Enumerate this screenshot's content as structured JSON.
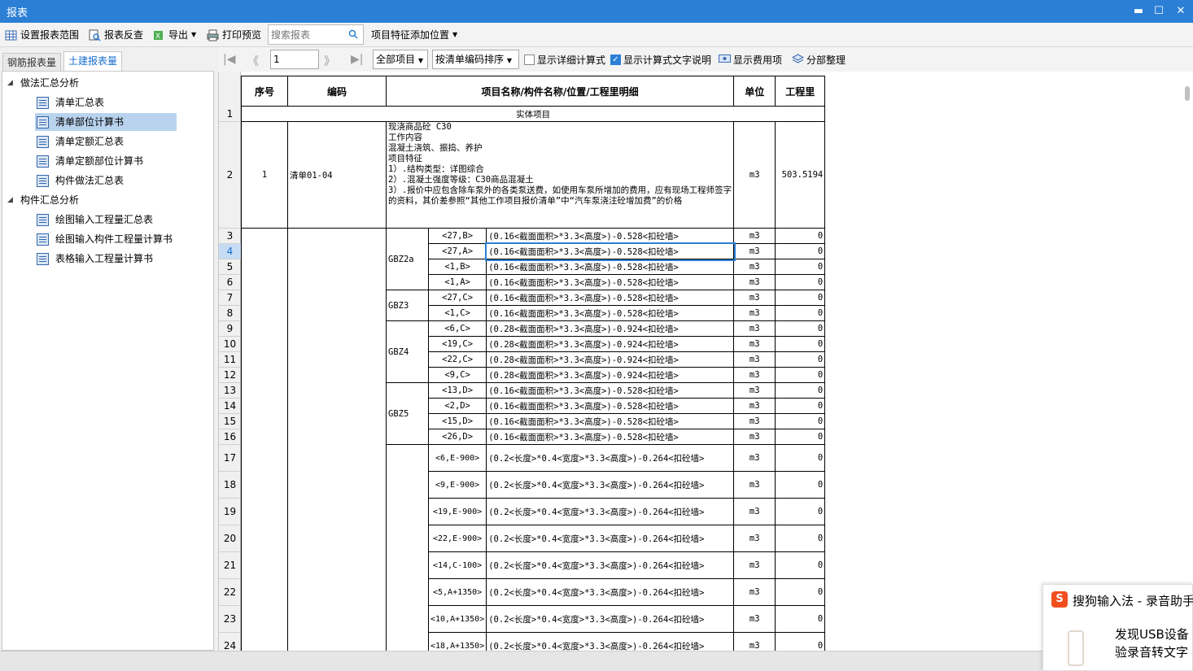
{
  "window": {
    "title": "报表",
    "minimize": "▬",
    "maximize": "☐",
    "close": "✕"
  },
  "toolbar": {
    "set_range": "设置报表范围",
    "reverse_check": "报表反查",
    "export": "导出",
    "print_preview": "打印预览",
    "search_placeholder": "搜索报表",
    "add_feature_pos": "项目特征添加位置"
  },
  "tabs": {
    "rebar": "钢筋报表量",
    "civil": "土建报表量"
  },
  "tree": {
    "group1": "做法汇总分析",
    "items1": [
      "清单汇总表",
      "清单部位计算书",
      "清单定额汇总表",
      "清单定额部位计算书",
      "构件做法汇总表"
    ],
    "group2": "构件汇总分析",
    "items2": [
      "绘图输入工程量汇总表",
      "绘图输入构件工程量计算书",
      "表格输入工程量计算书"
    ]
  },
  "nav": {
    "page": "1",
    "filter": "全部项目",
    "sort": "按清单编码排序",
    "show_detail": "显示详细计算式",
    "show_text": "显示计算式文字说明",
    "show_cost": "显示费用项",
    "split": "分部整理"
  },
  "table": {
    "headers": {
      "seq": "序号",
      "code": "编码",
      "name": "项目名称/构件名称/位置/工程里明细",
      "unit": "单位",
      "qty": "工程里"
    },
    "section": "实体项目",
    "item": {
      "seq": "1",
      "code": "清单01-04",
      "desc": "现浇商品砼 C30\n工作内容\n混凝土浇筑、振捣、养护\n项目特征\n1）.结构类型：详图综合\n2）.混凝土强度等级：C30商品混凝土\n3）.报价中应包含除车泵外的各类泵送费，如使用车泵所增加的费用，应有现场工程师签字的资料，其价差参照“其他工作项目报价清单”中“汽车泵浇注砼增加费”的价格",
      "unit": "m3",
      "qty": "503.5194"
    },
    "rows": [
      {
        "n": "3",
        "comp": "GBZ2a",
        "loc": "<27,B>",
        "formula": "(0.16<截面面积>*3.3<高度>)-0.528<扣砼墙>",
        "unit": "m3",
        "qty": "0"
      },
      {
        "n": "4",
        "comp": "",
        "loc": "<27,A>",
        "formula": "(0.16<截面面积>*3.3<高度>)-0.528<扣砼墙>",
        "unit": "m3",
        "qty": "0"
      },
      {
        "n": "5",
        "comp": "",
        "loc": "<1,B>",
        "formula": "(0.16<截面面积>*3.3<高度>)-0.528<扣砼墙>",
        "unit": "m3",
        "qty": "0"
      },
      {
        "n": "6",
        "comp": "",
        "loc": "<1,A>",
        "formula": "(0.16<截面面积>*3.3<高度>)-0.528<扣砼墙>",
        "unit": "m3",
        "qty": "0"
      },
      {
        "n": "7",
        "comp": "GBZ3",
        "loc": "<27,C>",
        "formula": "(0.16<截面面积>*3.3<高度>)-0.528<扣砼墙>",
        "unit": "m3",
        "qty": "0"
      },
      {
        "n": "8",
        "comp": "",
        "loc": "<1,C>",
        "formula": "(0.16<截面面积>*3.3<高度>)-0.528<扣砼墙>",
        "unit": "m3",
        "qty": "0"
      },
      {
        "n": "9",
        "comp": "GBZ4",
        "loc": "<6,C>",
        "formula": "(0.28<截面面积>*3.3<高度>)-0.924<扣砼墙>",
        "unit": "m3",
        "qty": "0"
      },
      {
        "n": "10",
        "comp": "",
        "loc": "<19,C>",
        "formula": "(0.28<截面面积>*3.3<高度>)-0.924<扣砼墙>",
        "unit": "m3",
        "qty": "0"
      },
      {
        "n": "11",
        "comp": "",
        "loc": "<22,C>",
        "formula": "(0.28<截面面积>*3.3<高度>)-0.924<扣砼墙>",
        "unit": "m3",
        "qty": "0"
      },
      {
        "n": "12",
        "comp": "",
        "loc": "<9,C>",
        "formula": "(0.28<截面面积>*3.3<高度>)-0.924<扣砼墙>",
        "unit": "m3",
        "qty": "0"
      },
      {
        "n": "13",
        "comp": "GBZ5",
        "loc": "<13,D>",
        "formula": "(0.16<截面面积>*3.3<高度>)-0.528<扣砼墙>",
        "unit": "m3",
        "qty": "0"
      },
      {
        "n": "14",
        "comp": "",
        "loc": "<2,D>",
        "formula": "(0.16<截面面积>*3.3<高度>)-0.528<扣砼墙>",
        "unit": "m3",
        "qty": "0"
      },
      {
        "n": "15",
        "comp": "",
        "loc": "<15,D>",
        "formula": "(0.16<截面面积>*3.3<高度>)-0.528<扣砼墙>",
        "unit": "m3",
        "qty": "0"
      },
      {
        "n": "16",
        "comp": "",
        "loc": "<26,D>",
        "formula": "(0.16<截面面积>*3.3<高度>)-0.528<扣砼墙>",
        "unit": "m3",
        "qty": "0"
      },
      {
        "n": "17",
        "comp": "",
        "loc": "<6,E-900>",
        "formula": "(0.2<长度>*0.4<宽度>*3.3<高度>)-0.264<扣砼墙>",
        "unit": "m3",
        "qty": "0"
      },
      {
        "n": "18",
        "comp": "",
        "loc": "<9,E-900>",
        "formula": "(0.2<长度>*0.4<宽度>*3.3<高度>)-0.264<扣砼墙>",
        "unit": "m3",
        "qty": "0"
      },
      {
        "n": "19",
        "comp": "",
        "loc": "<19,E-900>",
        "formula": "(0.2<长度>*0.4<宽度>*3.3<高度>)-0.264<扣砼墙>",
        "unit": "m3",
        "qty": "0"
      },
      {
        "n": "20",
        "comp": "",
        "loc": "<22,E-900>",
        "formula": "(0.2<长度>*0.4<宽度>*3.3<高度>)-0.264<扣砼墙>",
        "unit": "m3",
        "qty": "0"
      },
      {
        "n": "21",
        "comp": "",
        "loc": "<14,C-100>",
        "formula": "(0.2<长度>*0.4<宽度>*3.3<高度>)-0.264<扣砼墙>",
        "unit": "m3",
        "qty": "0"
      },
      {
        "n": "22",
        "comp": "",
        "loc": "<5,A+1350>",
        "formula": "(0.2<长度>*0.4<宽度>*3.3<高度>)-0.264<扣砼墙>",
        "unit": "m3",
        "qty": "0"
      },
      {
        "n": "23",
        "comp": "",
        "loc": "<10,A+1350>",
        "formula": "(0.2<长度>*0.4<宽度>*3.3<高度>)-0.264<扣砼墙>",
        "unit": "m3",
        "qty": "0"
      },
      {
        "n": "24",
        "comp": "",
        "loc": "<18,A+1350>",
        "formula": "(0.2<长度>*0.4<宽度>*3.3<高度>)-0.264<扣砼墙>",
        "unit": "m3",
        "qty": "0"
      }
    ]
  },
  "ime": {
    "title": "搜狗输入法 - 录音助手",
    "line1": "发现USB设备",
    "line2": "验录音转文字"
  },
  "colors": {
    "titlebar": "#2b7fd5",
    "selected": "#b9d3ee",
    "accent": "#1a6fcf"
  }
}
